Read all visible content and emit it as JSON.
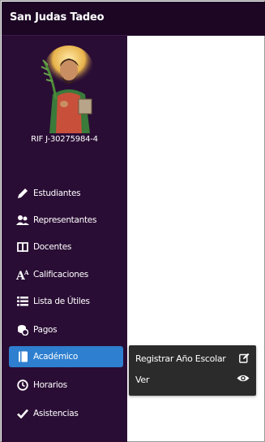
{
  "app": {
    "brand": "San Judas Tadeo",
    "rif": "RIF J-30275984-4"
  },
  "nav": {
    "items": [
      {
        "id": "estudiantes",
        "label": "Estudiantes",
        "icon": "pencil-icon"
      },
      {
        "id": "representantes",
        "label": "Representantes",
        "icon": "users-icon"
      },
      {
        "id": "docentes",
        "label": "Docentes",
        "icon": "book-icon"
      },
      {
        "id": "calificaciones",
        "label": "Calificaciones",
        "icon": "font-size-icon"
      },
      {
        "id": "lista-utiles",
        "label": "Lista de Útiles",
        "icon": "list-icon"
      },
      {
        "id": "pagos",
        "label": "Pagos",
        "icon": "coins-icon"
      },
      {
        "id": "academico",
        "label": "Académico",
        "icon": "book-solid-icon",
        "active": true
      },
      {
        "id": "horarios",
        "label": "Horarios",
        "icon": "clock-icon"
      },
      {
        "id": "asistencias",
        "label": "Asistencias",
        "icon": "check-icon"
      }
    ]
  },
  "submenu": {
    "items": [
      {
        "label": "Registrar Año Escolar",
        "icon": "edit-icon"
      },
      {
        "label": "Ver",
        "icon": "eye-icon"
      }
    ]
  },
  "colors": {
    "sidebar_bg": "#2a0d35",
    "header_bg": "#1c0624",
    "active_bg": "#2e7fcf",
    "submenu_bg": "#2b2b2b"
  }
}
